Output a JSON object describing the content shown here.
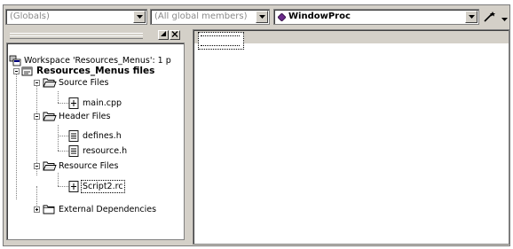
{
  "toolbar": {
    "scope_combo": {
      "value": "(Globals)"
    },
    "members_combo": {
      "value": "(All global members)"
    },
    "function_combo": {
      "value": "WindowProc"
    }
  },
  "left_pane": {
    "workspace_label": "Workspace 'Resources_Menus': 1 p",
    "project_label": "Resources_Menus files",
    "source_folder": "Source Files",
    "main_cpp": "main.cpp",
    "header_folder": "Header Files",
    "defines_h": "defines.h",
    "resource_h": "resource.h",
    "resource_folder": "Resource Files",
    "script2_rc": "Script2.rc",
    "external_folder": "External Dependencies"
  },
  "colors": {
    "chrome": "#d4d0c8",
    "border_dark": "#808080",
    "window_bg": "#ffffff"
  }
}
